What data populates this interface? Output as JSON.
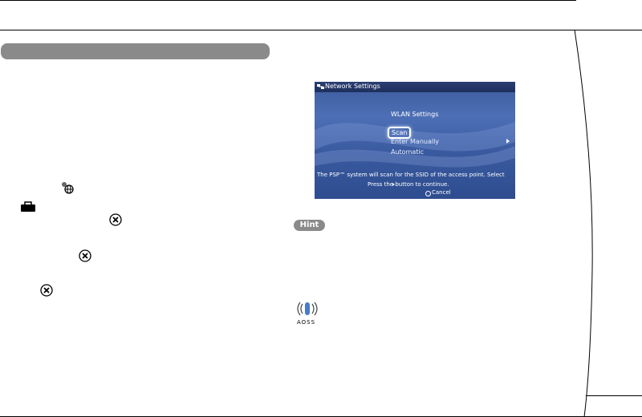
{
  "section_header": {
    "label": ""
  },
  "dialog_screen": {
    "title": "Network Settings",
    "menu_header": "WLAN Settings",
    "menu_items": [
      "Scan",
      "Enter Manually",
      "Automatic"
    ],
    "selected_item": "Scan",
    "info_text": "The PSP™ system will scan for the SSID of the access point. Select",
    "instruction_text": "Press the  button to continue.",
    "cancel_label": "Cancel",
    "colors": {
      "background": "#3d5b9e",
      "titlebar": "#1d2f5c",
      "text": "#ffffff"
    }
  },
  "hint": {
    "label": "Hint"
  },
  "aoss": {
    "label": "AOSS"
  },
  "icons": [
    "network-update-icon",
    "toolbox-icon",
    "cross-button-icon",
    "cross-button-icon",
    "cross-button-icon",
    "network-settings-icon",
    "aoss-icon"
  ]
}
